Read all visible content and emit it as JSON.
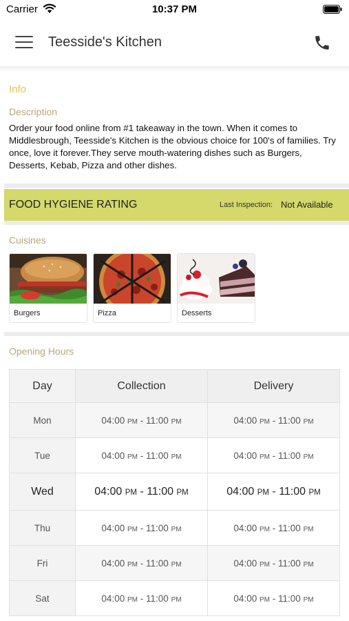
{
  "status_bar": {
    "carrier": "Carrier",
    "time": "10:37 PM"
  },
  "nav": {
    "title": "Teesside's Kitchen",
    "menu_icon": "hamburger-menu-icon",
    "phone_icon": "phone-icon"
  },
  "info": {
    "title": "Info",
    "description_label": "Description",
    "description": "Order your food online from #1 takeaway in the town. When it comes to Middlesbrough, Teesside's Kitchen is the obvious choice for 100's of families. Try once, love it forever.They serve mouth-watering dishes such as Burgers, Desserts, Kebab, Pizza and other dishes."
  },
  "hygiene": {
    "title": "FOOD HYGIENE RATING",
    "last_inspection_label": "Last Inspection:",
    "last_inspection_value": "Not Available",
    "color": "#d5d86a"
  },
  "cuisines": {
    "title": "Cuisines",
    "items": [
      {
        "label": "Burgers"
      },
      {
        "label": "Pizza"
      },
      {
        "label": "Desserts"
      }
    ]
  },
  "opening_hours": {
    "title": "Opening Hours",
    "headers": [
      "Day",
      "Collection",
      "Delivery"
    ],
    "rows": [
      {
        "day": "Mon",
        "c_open": "04:00",
        "c_close": "11:00",
        "d_open": "04:00",
        "d_close": "11:00"
      },
      {
        "day": "Tue",
        "c_open": "04:00",
        "c_close": "11:00",
        "d_open": "04:00",
        "d_close": "11:00"
      },
      {
        "day": "Wed",
        "c_open": "04:00",
        "c_close": "11:00",
        "d_open": "04:00",
        "d_close": "11:00"
      },
      {
        "day": "Thu",
        "c_open": "04:00",
        "c_close": "11:00",
        "d_open": "04:00",
        "d_close": "11:00"
      },
      {
        "day": "Fri",
        "c_open": "04:00",
        "c_close": "11:00",
        "d_open": "04:00",
        "d_close": "11:00"
      },
      {
        "day": "Sat",
        "c_open": "04:00",
        "c_close": "11:00",
        "d_open": "04:00",
        "d_close": "11:00"
      }
    ],
    "pm_label": "PM",
    "separator": "-"
  },
  "colors": {
    "accent_gold": "#e7c44a",
    "section_label": "#b8a77a"
  }
}
